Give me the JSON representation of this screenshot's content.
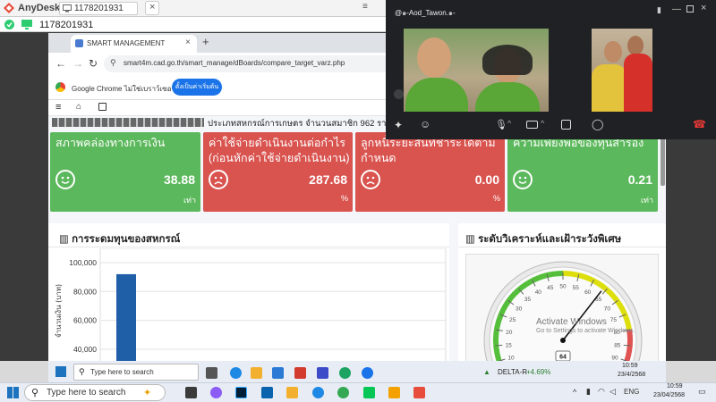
{
  "anydesk": {
    "title": "AnyDesk",
    "tab_id": "1178201931",
    "address_id": "1178201931"
  },
  "browser": {
    "tab_title": "SMART MANAGEMENT",
    "url": "smart4m.cad.go.th/smart_manage/dBoards/compare_target_varz.php",
    "infobar_text": "Google Chrome ไม่ใช่เบราว์เซอร์เริ่มต้น",
    "infobar_button": "ตั้งเป็นค่าเริ่มต้น"
  },
  "page": {
    "coop_line": "ประเภทสหกรณ์การเกษตร จำนวนสมาชิก 962 ราย",
    "cards": [
      {
        "title": "สภาพคล่องทางการเงิน",
        "value": "38.88",
        "unit": "เท่า",
        "status": "green"
      },
      {
        "title": "ค่าใช้จ่ายดำเนินงานต่อกำไร (ก่อนหักค่าใช้จ่ายดำเนินงาน)",
        "value": "287.68",
        "unit": "%",
        "status": "red"
      },
      {
        "title": "ลูกหนี้ระยะสั้นที่ชำระได้ตามกำหนด",
        "value": "0.00",
        "unit": "%",
        "status": "red"
      },
      {
        "title": "ความเพียงพอของทุนสำรอง",
        "value": "0.21",
        "unit": "เท่า",
        "status": "green"
      }
    ],
    "panel_left_title": "การระดมทุนของสหกรณ์",
    "panel_right_title": "ระดับวิเคราะห์และเฝ้าระวังพิเศษ",
    "gauge_value": "64",
    "watermark_line1": "Activate Windows",
    "watermark_line2": "Go to Settings to activate Windows."
  },
  "chart_data": {
    "type": "bar",
    "ylabel": "จำนวนเงิน (บาท)",
    "yticks": [
      "100,000",
      "80,000",
      "60,000",
      "40,000"
    ],
    "ylim": [
      30000,
      100000
    ],
    "series": [
      {
        "values": [
          92000
        ]
      }
    ]
  },
  "gauge_data": {
    "value": 64,
    "ticks": [
      "0",
      "5",
      "10",
      "15",
      "20",
      "25",
      "30",
      "35",
      "40",
      "45",
      "50",
      "55",
      "60",
      "65",
      "70",
      "75",
      "80",
      "85",
      "90",
      "95",
      "100"
    ]
  },
  "video": {
    "title": "@๑-Aod_Tawon.๑-"
  },
  "remote_taskbar": {
    "search": "Type here to search",
    "stock": "DELTA-R",
    "stock_change": "+4.69%",
    "time": "10:59",
    "date": "23/4/2568"
  },
  "taskbar": {
    "search": "Type here to search",
    "lang": "ENG",
    "time": "10:59",
    "date": "23/04/2568"
  }
}
